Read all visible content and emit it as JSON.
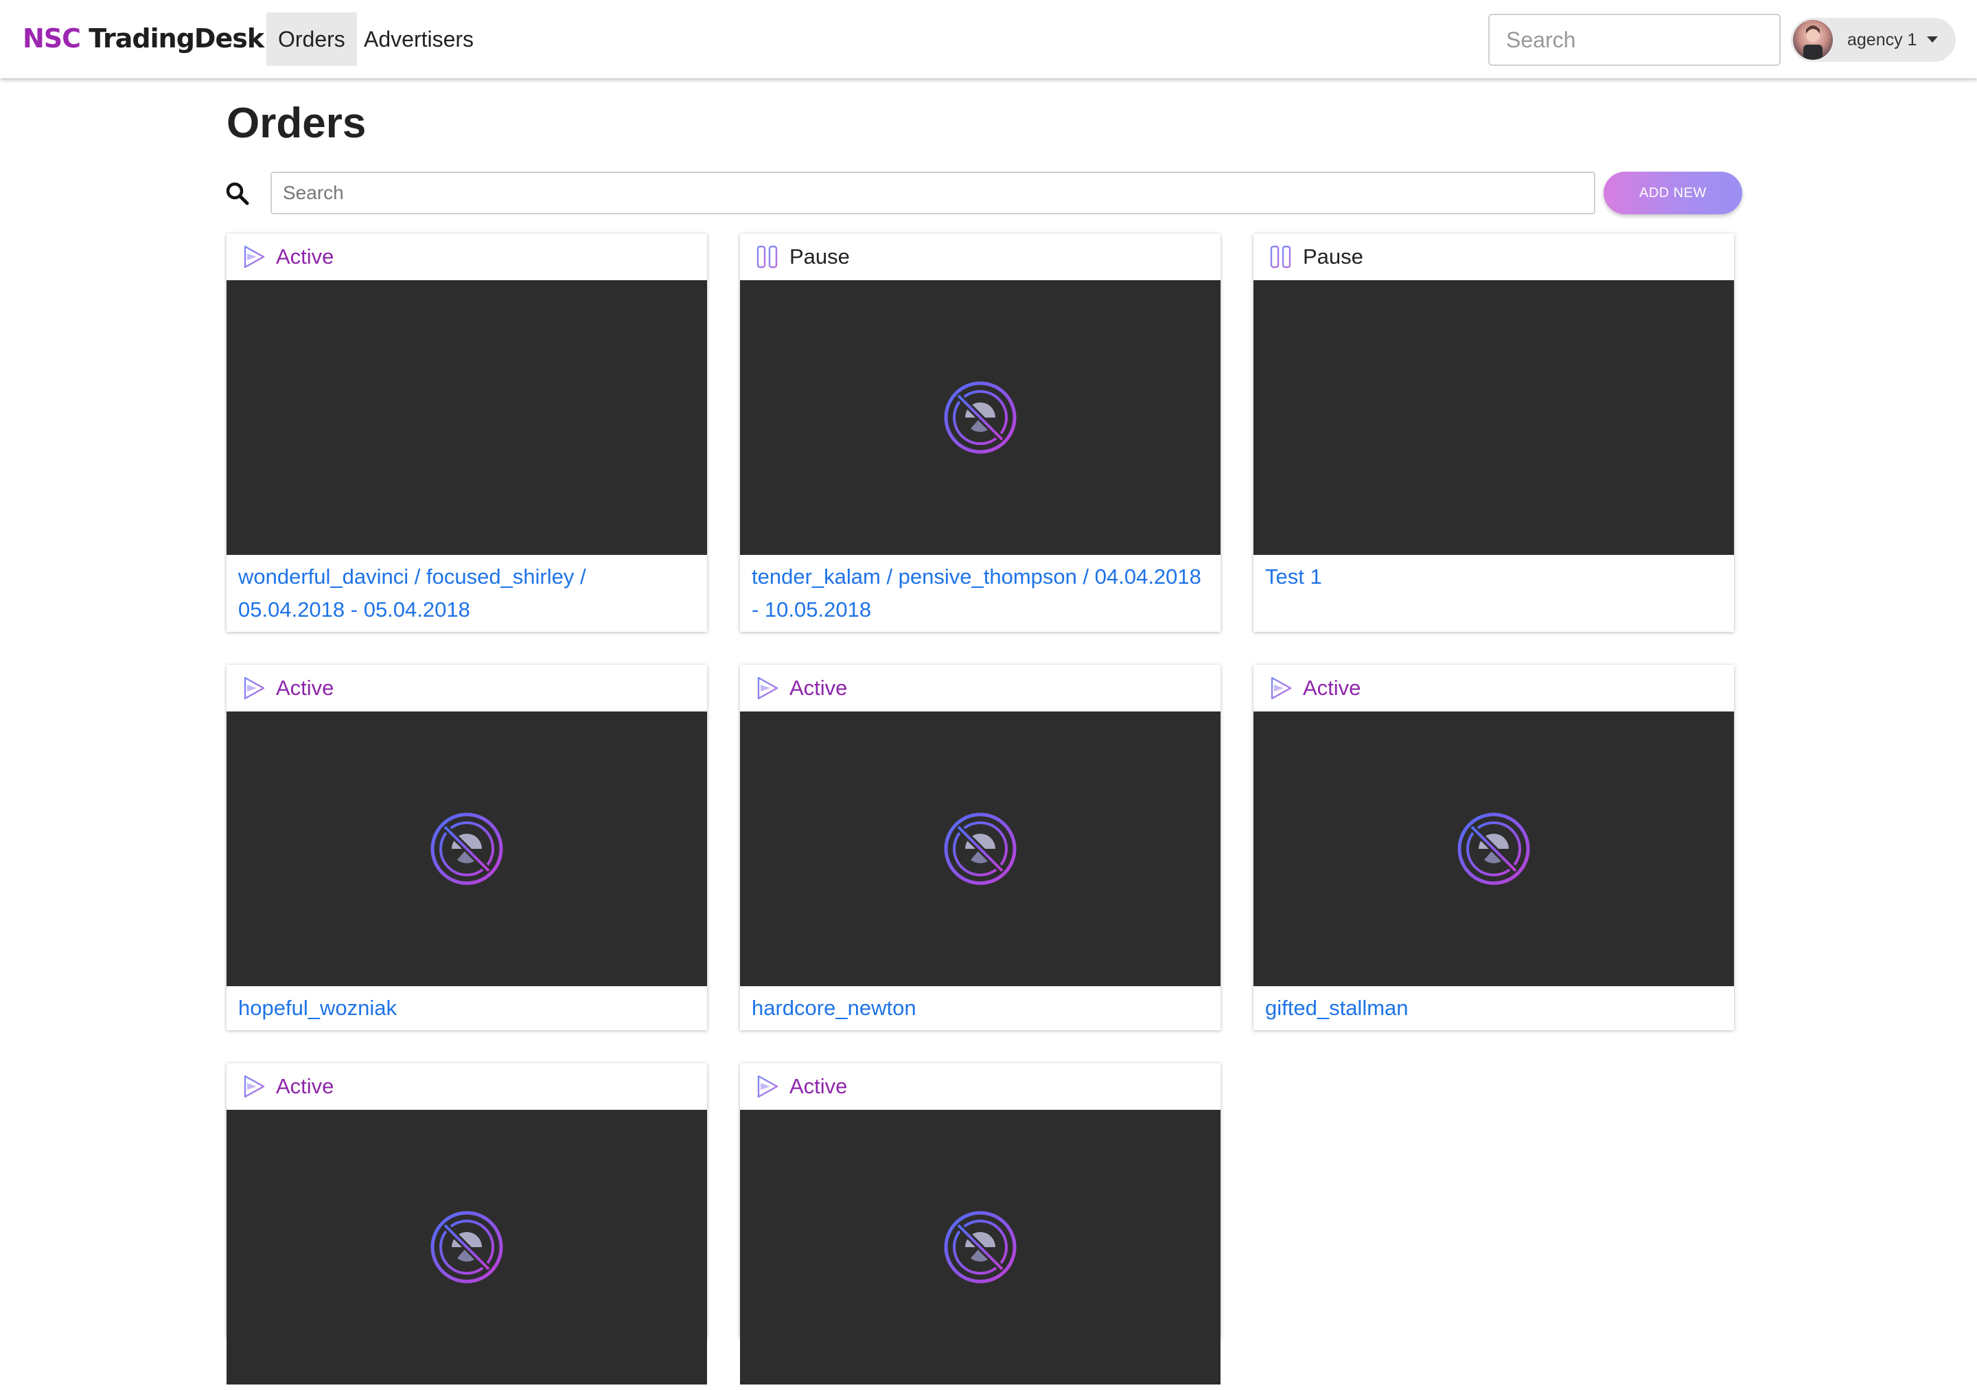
{
  "brand": {
    "part1": "NSC",
    "part2": "TradingDesk"
  },
  "nav": {
    "items": [
      {
        "label": "Orders",
        "active": true
      },
      {
        "label": "Advertisers",
        "active": false
      }
    ],
    "search_placeholder": "Search",
    "user": {
      "name": "agency 1"
    }
  },
  "page": {
    "title": "Orders",
    "search_placeholder": "Search",
    "add_button": "ADD NEW"
  },
  "colors": {
    "accent_active": "#8e24aa",
    "link": "#1e73e8",
    "media_bg": "#2d2d2d"
  },
  "orders": [
    {
      "status": "Active",
      "title": "wonderful_davinci / focused_shirley / 05.04.2018 - 05.04.2018",
      "has_image_icon": false
    },
    {
      "status": "Pause",
      "title": "tender_kalam / pensive_thompson / 04.04.2018 - 10.05.2018",
      "has_image_icon": true
    },
    {
      "status": "Pause",
      "title": "Test 1",
      "has_image_icon": false
    },
    {
      "status": "Active",
      "title": "hopeful_wozniak",
      "has_image_icon": true
    },
    {
      "status": "Active",
      "title": "hardcore_newton",
      "has_image_icon": true
    },
    {
      "status": "Active",
      "title": "gifted_stallman",
      "has_image_icon": true
    },
    {
      "status": "Active",
      "title": "",
      "has_image_icon": true
    },
    {
      "status": "Active",
      "title": "",
      "has_image_icon": true
    }
  ]
}
